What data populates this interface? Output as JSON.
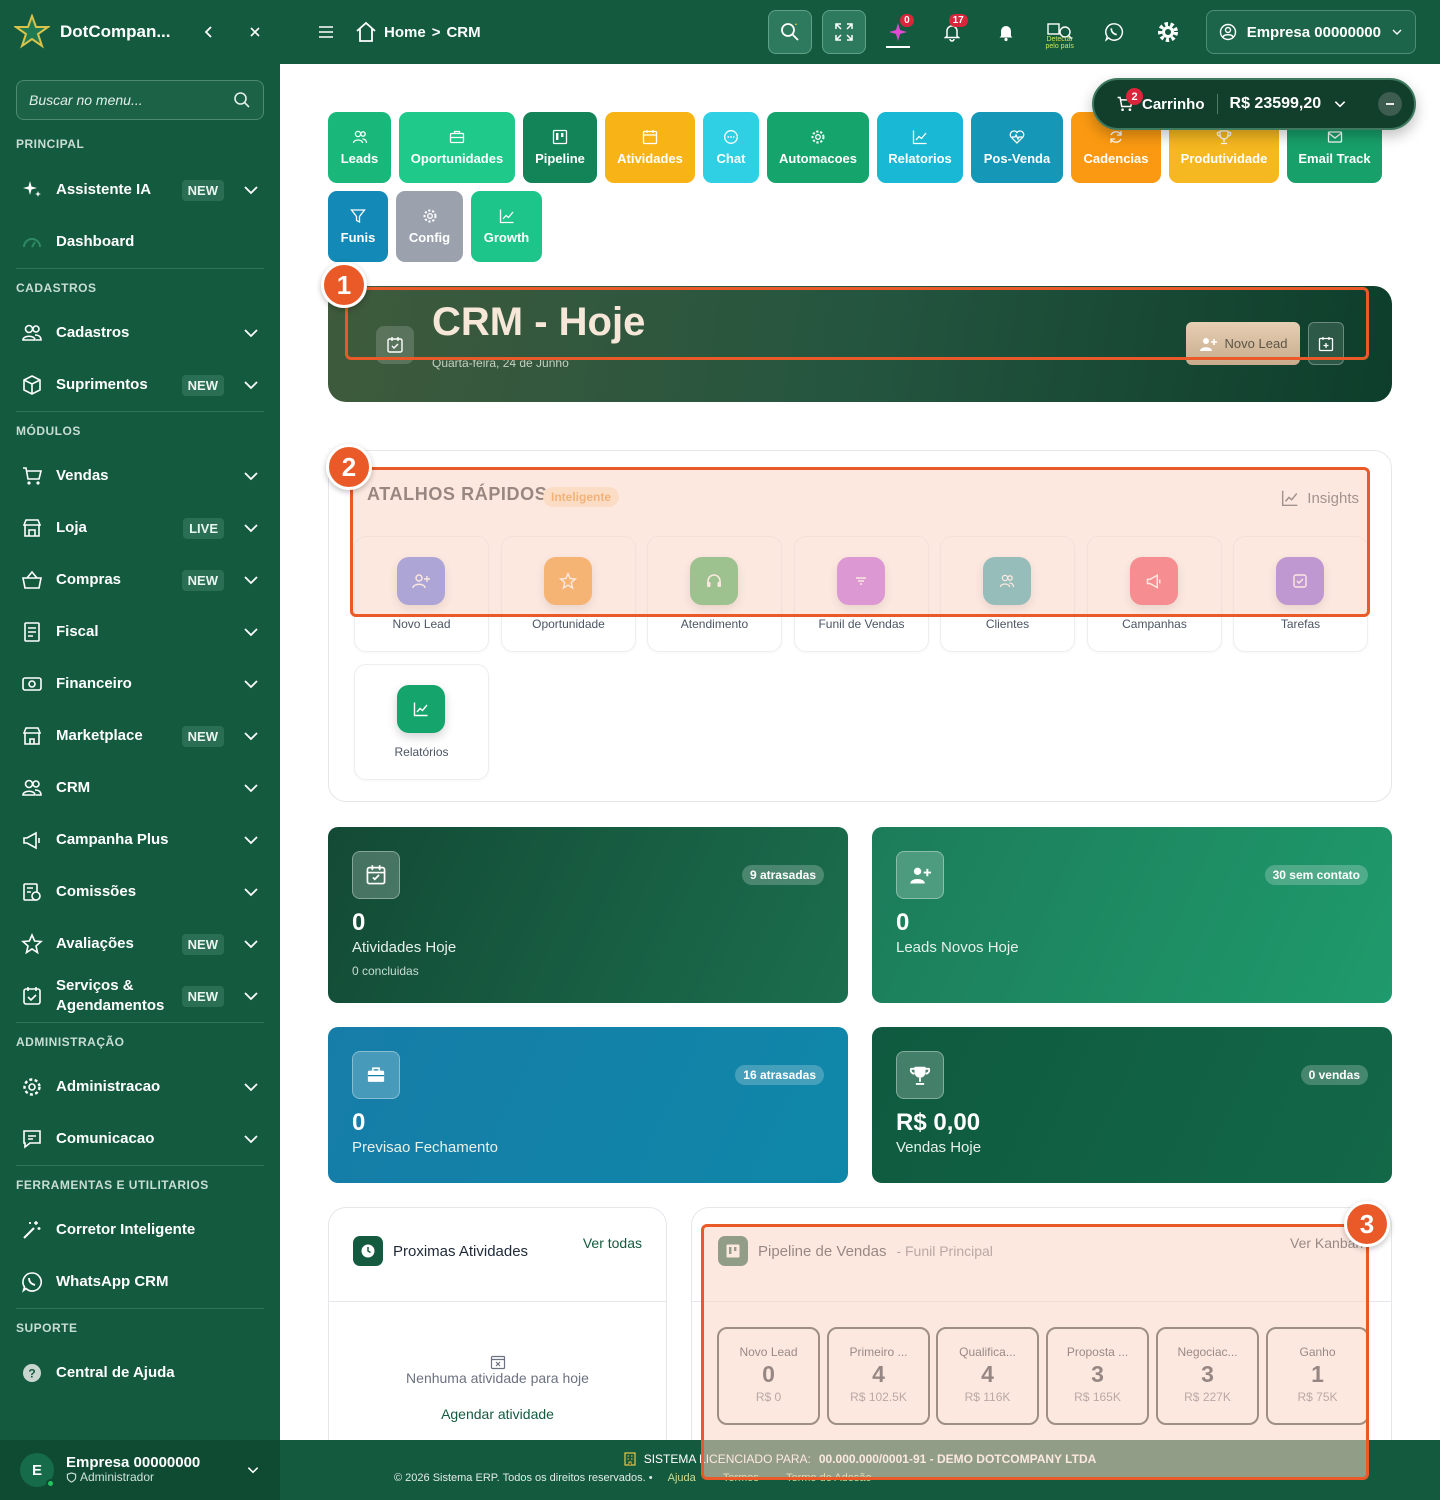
{
  "sidebar": {
    "brand": "DotCompan...",
    "search_placeholder": "Buscar no menu...",
    "sections": {
      "principal": "PRINCIPAL",
      "cadastros": "CADASTROS",
      "modulos": "MÓDULOS",
      "administracao": "ADMINISTRAÇÃO",
      "ferramentas": "FERRAMENTAS E UTILITARIOS",
      "suporte": "SUPORTE"
    },
    "items": {
      "assistente": {
        "label": "Assistente IA",
        "badge": "NEW"
      },
      "dashboard": {
        "label": "Dashboard"
      },
      "cadastros": {
        "label": "Cadastros"
      },
      "suprimentos": {
        "label": "Suprimentos",
        "badge": "NEW"
      },
      "vendas": {
        "label": "Vendas"
      },
      "loja": {
        "label": "Loja",
        "badge": "LIVE"
      },
      "compras": {
        "label": "Compras",
        "badge": "NEW"
      },
      "fiscal": {
        "label": "Fiscal"
      },
      "financeiro": {
        "label": "Financeiro"
      },
      "marketplace": {
        "label": "Marketplace",
        "badge": "NEW"
      },
      "crm": {
        "label": "CRM"
      },
      "campanha": {
        "label": "Campanha Plus"
      },
      "comissoes": {
        "label": "Comissões"
      },
      "avaliacoes": {
        "label": "Avaliações",
        "badge": "NEW"
      },
      "servicos": {
        "label1": "Serviços &",
        "label2": "Agendamentos",
        "badge": "NEW"
      },
      "administracao": {
        "label": "Administracao"
      },
      "comunicacao": {
        "label": "Comunicacao"
      },
      "corretor": {
        "label": "Corretor Inteligente"
      },
      "whatsapp": {
        "label": "WhatsApp CRM"
      },
      "ajuda": {
        "label": "Central de Ajuda"
      }
    },
    "user": {
      "initial": "E",
      "name": "Empresa 00000000",
      "role": "Administrador"
    }
  },
  "header": {
    "breadcrumb_home": "Home",
    "breadcrumb_current": "CRM",
    "sparkle_count": "0",
    "notif_count": "17",
    "detect_label": "Detectar pelo país",
    "company": "Empresa 00000000"
  },
  "cart": {
    "count": "2",
    "label": "Carrinho",
    "total": "R$ 23599,20"
  },
  "modules": [
    {
      "label": "Leads",
      "color": "#19b87a",
      "icon": "users-icon"
    },
    {
      "label": "Oportunidades",
      "color": "#1fc98a",
      "icon": "briefcase-icon"
    },
    {
      "label": "Pipeline",
      "color": "#128458",
      "icon": "kanban-icon"
    },
    {
      "label": "Atividades",
      "color": "#f8b416",
      "icon": "calendar-icon"
    },
    {
      "label": "Chat",
      "color": "#2fd0e4",
      "icon": "chat-icon"
    },
    {
      "label": "Automacoes",
      "color": "#14a46c",
      "icon": "gear-icon"
    },
    {
      "label": "Relatorios",
      "color": "#19b8d4",
      "icon": "chart-icon"
    },
    {
      "label": "Pos-Venda",
      "color": "#1597b8",
      "icon": "heart-pulse-icon"
    },
    {
      "label": "Cadencias",
      "color": "#fb9a12",
      "icon": "refresh-icon"
    },
    {
      "label": "Produtividade",
      "color": "#f6b820",
      "icon": "trophy-icon"
    },
    {
      "label": "Email Track",
      "color": "#17a06a",
      "icon": "mail-icon"
    },
    {
      "label": "Funis",
      "color": "#1289b6",
      "icon": "filter-icon"
    },
    {
      "label": "Config",
      "color": "#9ba2ad",
      "icon": "gear-icon"
    },
    {
      "label": "Growth",
      "color": "#1ec58a",
      "icon": "chart-icon"
    }
  ],
  "hero": {
    "title": "CRM - Hoje",
    "date": "Quarta-feira, 24 de Junho",
    "new_lead": "Novo Lead"
  },
  "quick": {
    "title": "ATALHOS RÁPIDOS",
    "tag": "Inteligente",
    "insights": "Insights",
    "items": [
      {
        "label": "Novo Lead",
        "color": "#4f6be8",
        "icon": "user-plus-icon"
      },
      {
        "label": "Oportunidade",
        "color": "#f08a12",
        "icon": "star-icon"
      },
      {
        "label": "Atendimento",
        "color": "#2ea84f",
        "icon": "headset-icon"
      },
      {
        "label": "Funil de Vendas",
        "color": "#b64fe2",
        "icon": "filter-icon"
      },
      {
        "label": "Clientes",
        "color": "#1fa0b0",
        "icon": "users-icon"
      },
      {
        "label": "Campanhas",
        "color": "#ef3553",
        "icon": "megaphone-icon"
      },
      {
        "label": "Tarefas",
        "color": "#7a4fe0",
        "icon": "check-square-icon"
      },
      {
        "label": "Relatórios",
        "color": "#14a46c",
        "icon": "chart-icon"
      }
    ]
  },
  "stats": [
    {
      "value": "0",
      "label": "Atividades Hoje",
      "sub": "0 concluidas",
      "pill": "9 atrasadas"
    },
    {
      "value": "0",
      "label": "Leads Novos Hoje",
      "sub": "",
      "pill": "30 sem contato"
    },
    {
      "value": "0",
      "label": "Previsao Fechamento",
      "sub": "",
      "pill": "16 atrasadas"
    },
    {
      "value": "R$ 0,00",
      "label": "Vendas Hoje",
      "sub": "",
      "pill": "0 vendas"
    }
  ],
  "activities": {
    "title": "Proximas Atividades",
    "link": "Ver todas",
    "empty": "Nenhuma atividade para hoje",
    "schedule": "Agendar atividade"
  },
  "pipeline": {
    "title": "Pipeline de Vendas",
    "subtitle": "- Funil Principal",
    "link": "Ver Kanban",
    "stages": [
      {
        "name": "Novo Lead",
        "count": "0",
        "value": "R$ 0"
      },
      {
        "name": "Primeiro ...",
        "count": "4",
        "value": "R$ 102.5K"
      },
      {
        "name": "Qualifica...",
        "count": "4",
        "value": "R$ 116K"
      },
      {
        "name": "Proposta ...",
        "count": "3",
        "value": "R$ 165K"
      },
      {
        "name": "Negociac...",
        "count": "3",
        "value": "R$ 227K"
      },
      {
        "name": "Ganho",
        "count": "1",
        "value": "R$ 75K"
      }
    ]
  },
  "footer": {
    "licensed_prefix": "SISTEMA LICENCIADO PARA:",
    "licensed_to": "00.000.000/0001-91 - DEMO DOTCOMPANY LTDA",
    "copyright": "© 2026 Sistema ERP. Todos os direitos reservados.",
    "links": [
      "Ajuda",
      "Termos",
      "Termo de Adesão"
    ]
  },
  "annotations": [
    "1",
    "2",
    "3"
  ]
}
